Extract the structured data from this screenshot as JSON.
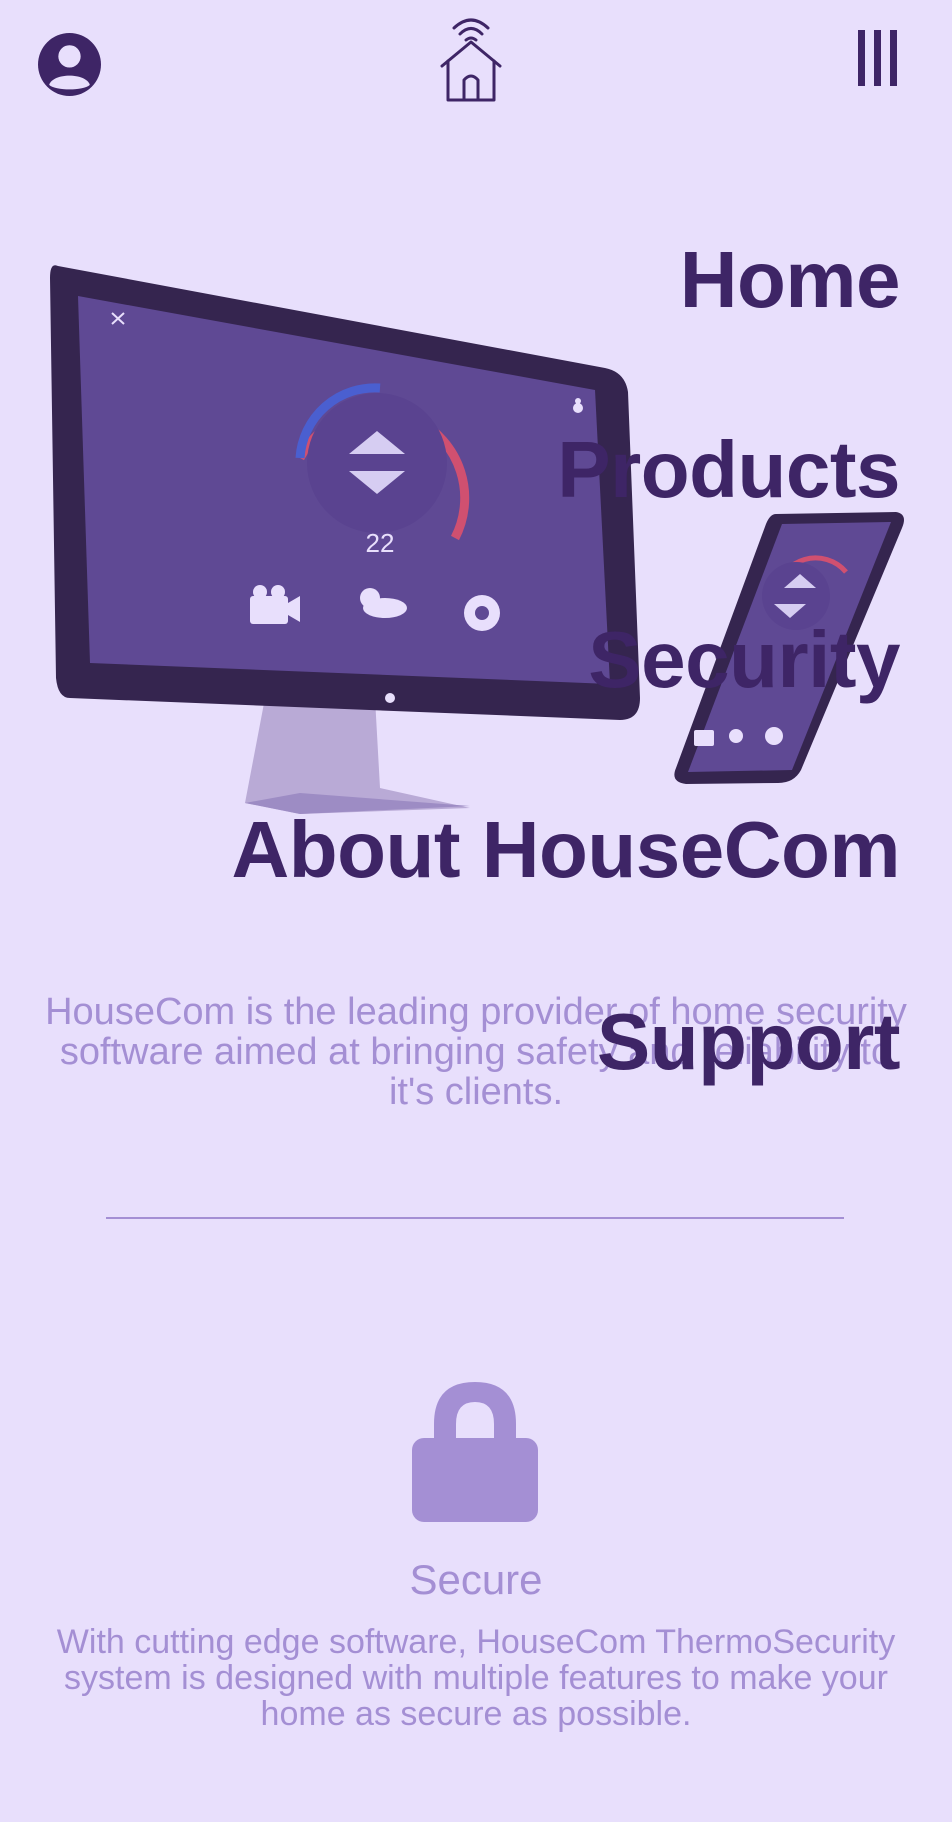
{
  "header": {
    "profile_icon": "user-circle-icon",
    "logo_icon": "smart-home-wifi-icon",
    "menu_icon": "vertical-bars-menu-icon"
  },
  "hero": {
    "thermostat_value": "22"
  },
  "nav": {
    "items": [
      {
        "label": "Home"
      },
      {
        "label": "Products"
      },
      {
        "label": "Security"
      },
      {
        "label": "About HouseCom"
      },
      {
        "label": "Support"
      }
    ]
  },
  "about": {
    "text": "HouseCom is the leading provider of home security software aimed at bringing safety and reliability to it's clients."
  },
  "feature": {
    "icon": "lock-icon",
    "title": "Secure",
    "description": "With cutting edge software, HouseCom ThermoSecurity system is designed with multiple features to make your home as secure as possible."
  },
  "colors": {
    "background": "#e8dffc",
    "primary_dark": "#3e2566",
    "accent_light": "#a48fd4",
    "screen": "#5f4994"
  }
}
